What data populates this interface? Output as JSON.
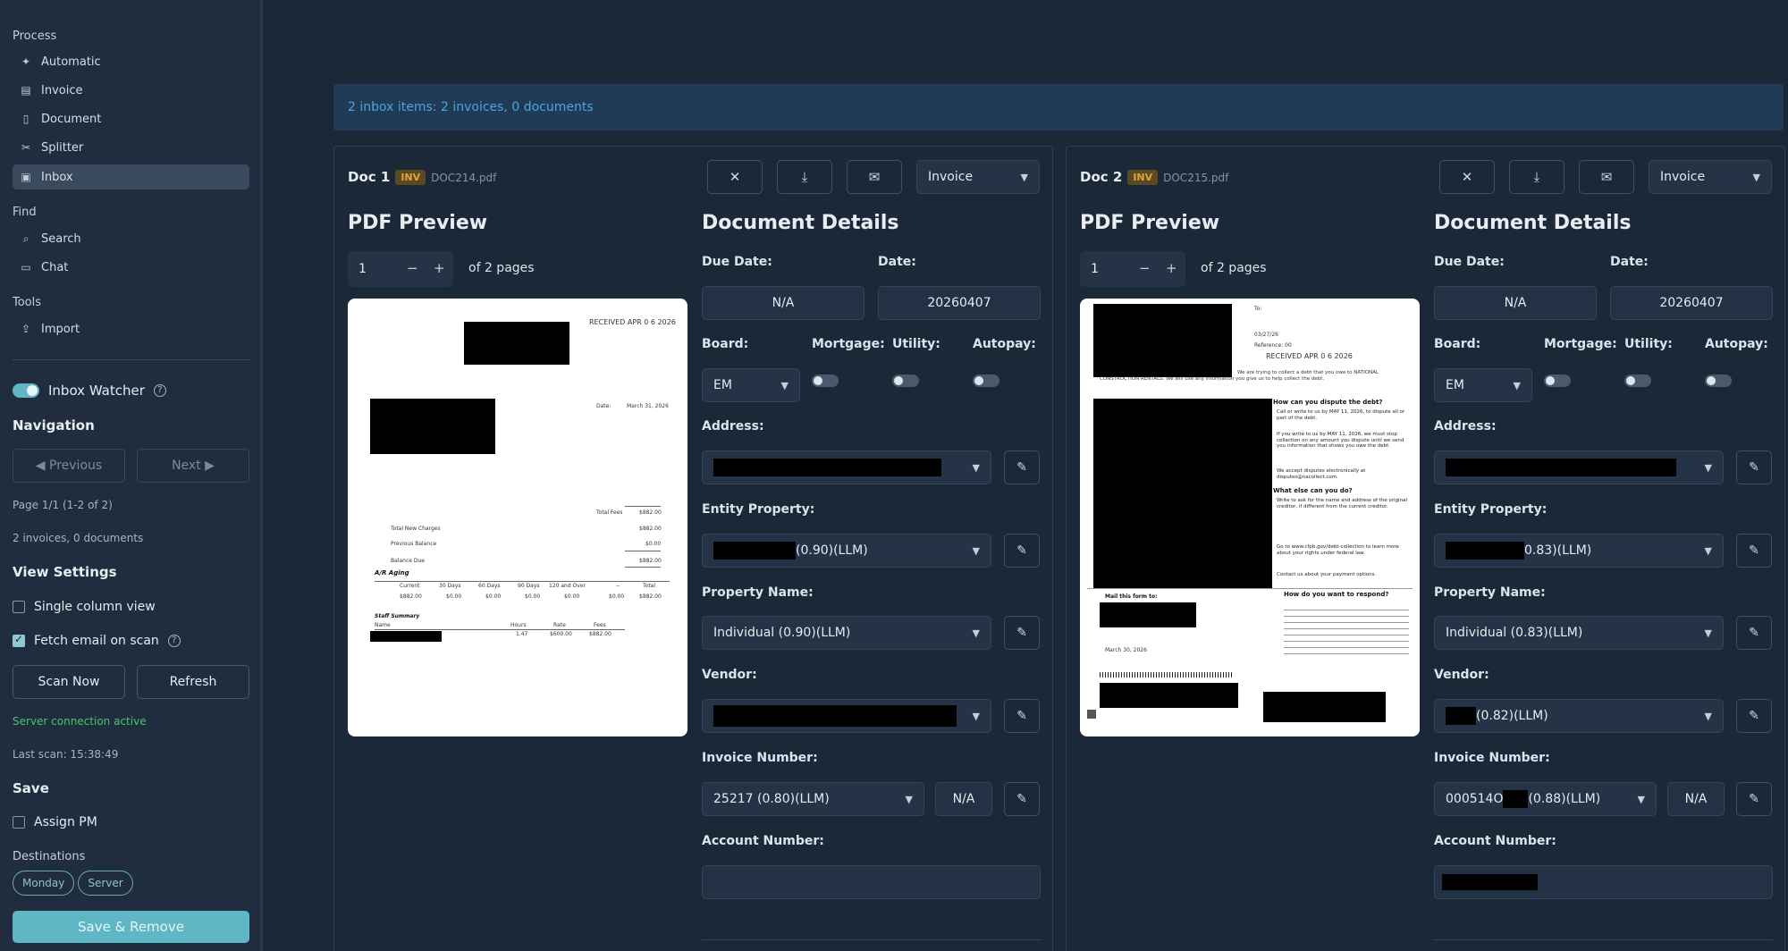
{
  "sidebar": {
    "process_label": "Process",
    "process_items": [
      {
        "label": "Automatic",
        "icon": "sparkle-icon"
      },
      {
        "label": "Invoice",
        "icon": "receipt-icon"
      },
      {
        "label": "Document",
        "icon": "file-icon"
      },
      {
        "label": "Splitter",
        "icon": "scissors-icon"
      },
      {
        "label": "Inbox",
        "icon": "inbox-icon",
        "active": true
      }
    ],
    "find_label": "Find",
    "find_items": [
      {
        "label": "Search",
        "icon": "search-icon"
      },
      {
        "label": "Chat",
        "icon": "chat-icon"
      }
    ],
    "tools_label": "Tools",
    "tools_items": [
      {
        "label": "Import",
        "icon": "upload-icon"
      }
    ],
    "inbox_watcher_label": "Inbox Watcher",
    "navigation_label": "Navigation",
    "previous_label": "◀ Previous",
    "next_label": "Next ▶",
    "page_info": "Page 1/1 (1-2 of 2)",
    "counts_info": "2 invoices, 0 documents",
    "view_settings_label": "View Settings",
    "single_column_label": "Single column view",
    "fetch_email_label": "Fetch email on scan",
    "scan_now_label": "Scan Now",
    "refresh_label": "Refresh",
    "server_status": "Server connection active",
    "last_scan": "Last scan: 15:38:49",
    "save_label": "Save",
    "assign_pm_label": "Assign PM",
    "destinations_label": "Destinations",
    "destinations": [
      "Monday",
      "Server"
    ],
    "save_remove_label": "Save & Remove"
  },
  "banner": "2 inbox items: 2 invoices, 0 documents",
  "docs": [
    {
      "title": "Doc 1",
      "badge": "INV",
      "filename": "DOC214.pdf",
      "type_select": "Invoice",
      "pdf_preview_label": "PDF Preview",
      "page_value": "1",
      "of_pages": "of 2 pages",
      "details_label": "Document Details",
      "due_date_label": "Due Date:",
      "due_date": "N/A",
      "date_label": "Date:",
      "date": "20260407",
      "board_label": "Board:",
      "board": "EM",
      "mortgage_label": "Mortgage:",
      "utility_label": "Utility:",
      "autopay_label": "Autopay:",
      "address_label": "Address:",
      "entity_label": "Entity Property:",
      "entity_suffix": "(0.90)(LLM)",
      "property_name_label": "Property Name:",
      "property_name": "Individual (0.90)(LLM)",
      "vendor_label": "Vendor:",
      "invoice_number_label": "Invoice Number:",
      "invoice_number": "25217 (0.80)(LLM)",
      "invoice_na": "N/A",
      "account_number_label": "Account Number:"
    },
    {
      "title": "Doc 2",
      "badge": "INV",
      "filename": "DOC215.pdf",
      "type_select": "Invoice",
      "pdf_preview_label": "PDF Preview",
      "page_value": "1",
      "of_pages": "of 2 pages",
      "details_label": "Document Details",
      "due_date_label": "Due Date:",
      "due_date": "N/A",
      "date_label": "Date:",
      "date": "20260407",
      "board_label": "Board:",
      "board": "EM",
      "mortgage_label": "Mortgage:",
      "utility_label": "Utility:",
      "autopay_label": "Autopay:",
      "address_label": "Address:",
      "entity_label": "Entity Property:",
      "entity_suffix": "0.83)(LLM)",
      "property_name_label": "Property Name:",
      "property_name": "Individual (0.83)(LLM)",
      "vendor_label": "Vendor:",
      "vendor_suffix": "(0.82)(LLM)",
      "invoice_number_label": "Invoice Number:",
      "invoice_number_prefix": "000514O",
      "invoice_number_suffix": "(0.88)(LLM)",
      "invoice_na": "N/A",
      "account_number_label": "Account Number:"
    }
  ],
  "preview1": {
    "received": "RECEIVED APR 0 6 2026",
    "date_label": "Date:",
    "date": "March 31, 2026",
    "total_fees": "Total Fees",
    "total_fees_val": "$882.00",
    "total_new_charges": "Total New Charges",
    "total_new_charges_val": "$882.00",
    "previous_balance": "Previous Balance",
    "previous_balance_val": "$0.00",
    "balance_due": "Balance Due",
    "balance_due_val": "$882.00",
    "ar_aging": "A/R Aging",
    "aging_headers": [
      "Current",
      "30 Days",
      "60 Days",
      "90 Days",
      "120 and Over",
      "--",
      "Total"
    ],
    "aging_values": [
      "$882.00",
      "$0.00",
      "$0.00",
      "$0.00",
      "$0.00",
      "$0.00",
      "$882.00"
    ],
    "staff_summary": "Staff Summary",
    "staff_headers": [
      "Name",
      "Hours",
      "Rate",
      "Fees"
    ],
    "staff_values": [
      "1.47",
      "$600.00",
      "$882.00"
    ]
  },
  "preview2": {
    "to": "To:",
    "date_small": "03/27/26",
    "reference": "Reference: 00",
    "received": "RECEIVED APR 0 6 2026",
    "construction": "CONSTRUCTION RENTALS. We will use any information you give us to help collect the debt.",
    "collect_line": "We are trying to collect a debt that you owe to NATIONAL",
    "h_dispute": "How can you dispute the debt?",
    "dispute_1": "Call or write to us by MAY 11, 2026, to dispute all or part of the debt.",
    "dispute_2": "If you write to us by MAY 11, 2026, we must stop collection on any amount you dispute until we send you information that shows you owe the debt.",
    "dispute_3": "We accept disputes electronically at disputes@nacollect.com.",
    "h_else": "What else can you do?",
    "else_1": "Write to ask for the name and address of the original creditor, if different from the current creditor.",
    "else_2": "Go to www.cfpb.gov/debt-collection to learn more about your rights under federal law.",
    "else_3": "Contact us about your payment options.",
    "mail_form": "Mail this form to:",
    "respond": "How do you want to respond?",
    "march30": "March 30, 2026"
  }
}
